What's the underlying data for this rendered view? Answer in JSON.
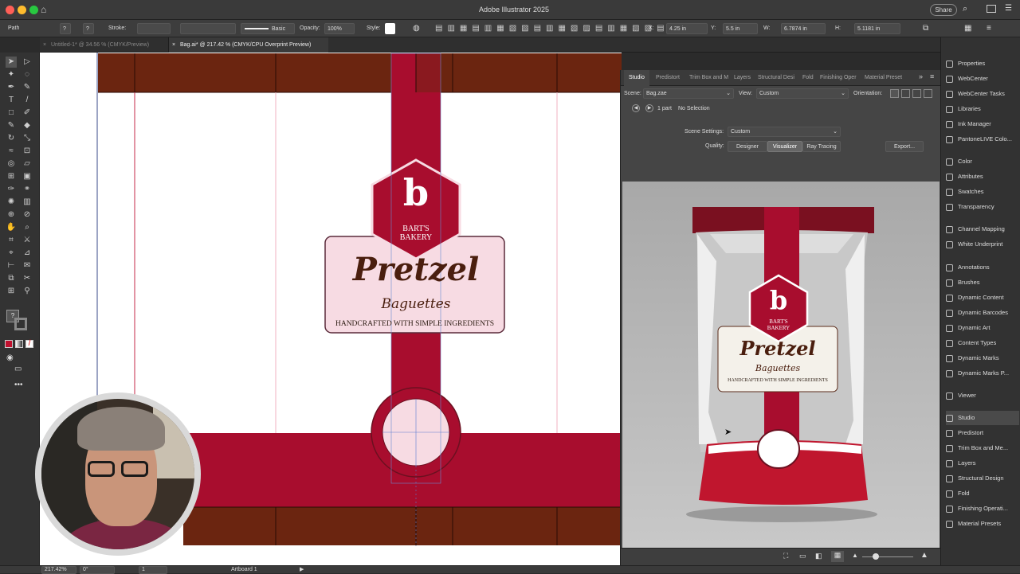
{
  "app": {
    "title": "Adobe Illustrator 2025",
    "share_label": "Share"
  },
  "control_bar": {
    "selection_type": "Path",
    "stroke_label": "Stroke:",
    "brush_label": "Basic",
    "opacity_label": "Opacity:",
    "opacity_value": "100%",
    "style_label": "Style:",
    "x_label": "X:",
    "x_value": "4.25 in",
    "y_label": "Y:",
    "y_value": "5.5 in",
    "w_label": "W:",
    "w_value": "6.7874 in",
    "h_label": "H:",
    "h_value": "5.1181 in"
  },
  "doc_tabs": [
    {
      "label": "Untitled-1* @ 34.56 % (CMYK/Preview)"
    },
    {
      "label": "Bag.ai* @ 217.42 % (CMYK/CPU Overprint Preview)"
    }
  ],
  "artwork": {
    "brand_letter": "b",
    "brand_line1": "BART'S",
    "brand_line2": "BAKERY",
    "product": "Pretzel",
    "product_sub": "Baguettes",
    "tagline": "HANDCRAFTED WITH SIMPLE INGREDIENTS"
  },
  "studio": {
    "tabs": [
      "Studio",
      "Predistort",
      "Trim Box and M",
      "Layers",
      "Structural Desi",
      "Fold",
      "Finishing Oper",
      "Material Preset"
    ],
    "scene_label": "Scene:",
    "scene_value": "Bag.zae",
    "view_label": "View:",
    "view_value": "Custom",
    "orientation_label": "Orientation:",
    "parts": "1 part",
    "selection": "No Selection",
    "scene_settings_label": "Scene Settings:",
    "scene_settings_value": "Custom",
    "quality_label": "Quality:",
    "quality_options": [
      "Designer",
      "Visualizer",
      "Ray Tracing"
    ],
    "export_label": "Export..."
  },
  "right_panel": [
    {
      "label": "Properties",
      "icon": "properties-icon"
    },
    {
      "label": "WebCenter",
      "icon": "webcenter-icon"
    },
    {
      "label": "WebCenter Tasks",
      "icon": "tasks-icon"
    },
    {
      "label": "Libraries",
      "icon": "libraries-icon"
    },
    {
      "label": "Ink Manager",
      "icon": "ink-icon"
    },
    {
      "label": "PantoneLIVE Colo...",
      "icon": "pantone-icon"
    },
    {
      "label": "Color",
      "icon": "color-icon"
    },
    {
      "label": "Attributes",
      "icon": "attributes-icon"
    },
    {
      "label": "Swatches",
      "icon": "swatches-icon"
    },
    {
      "label": "Transparency",
      "icon": "transparency-icon"
    },
    {
      "label": "Channel Mapping",
      "icon": "channel-icon"
    },
    {
      "label": "White Underprint",
      "icon": "white-icon"
    },
    {
      "label": "Annotations",
      "icon": "annotations-icon"
    },
    {
      "label": "Brushes",
      "icon": "brushes-icon"
    },
    {
      "label": "Dynamic Content",
      "icon": "dyncontent-icon"
    },
    {
      "label": "Dynamic Barcodes",
      "icon": "barcode-icon"
    },
    {
      "label": "Dynamic Art",
      "icon": "dynart-icon"
    },
    {
      "label": "Content Types",
      "icon": "contenttypes-icon"
    },
    {
      "label": "Dynamic Marks",
      "icon": "marks-icon"
    },
    {
      "label": "Dynamic Marks P...",
      "icon": "marksp-icon"
    },
    {
      "label": "Viewer",
      "icon": "viewer-icon"
    },
    {
      "label": "Studio",
      "icon": "studio-icon"
    },
    {
      "label": "Predistort",
      "icon": "predistort-icon"
    },
    {
      "label": "Trim Box and Me...",
      "icon": "trimbox-icon"
    },
    {
      "label": "Layers",
      "icon": "layers-icon"
    },
    {
      "label": "Structural Design",
      "icon": "structural-icon"
    },
    {
      "label": "Fold",
      "icon": "fold-icon"
    },
    {
      "label": "Finishing Operati...",
      "icon": "finishing-icon"
    },
    {
      "label": "Material Presets",
      "icon": "presets-icon"
    }
  ],
  "status": {
    "zoom": "217.42%",
    "rotate": "0°",
    "artboard_num": "1",
    "artboard_name": "Artboard 1"
  },
  "colors": {
    "maroon": "#6b2510",
    "crimson": "#a80d2e",
    "pink": "#f7dbe3",
    "brown_text": "#4a1e0e"
  }
}
